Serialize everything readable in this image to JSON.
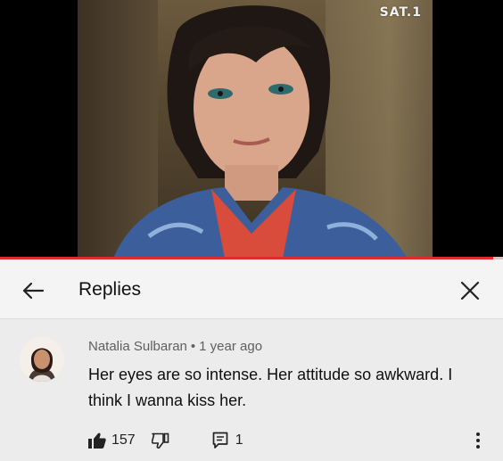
{
  "video": {
    "channel_logo": "SAT.1",
    "progress_fraction": 0.98
  },
  "replies": {
    "title": "Replies"
  },
  "comment": {
    "author": "Natalia Sulbaran",
    "separator": "•",
    "time": "1 year ago",
    "text": "Her eyes are so intense. Her attitude so awkward. I think I wanna kiss her.",
    "like_count": "157",
    "reply_count": "1"
  },
  "colors": {
    "accent_progress": "#e22b2b",
    "header_bg": "#f4f4f4",
    "comment_bg": "#ececec"
  },
  "icons": [
    "back-arrow-icon",
    "close-icon",
    "thumbs-up-icon",
    "thumbs-down-icon",
    "reply-icon",
    "more-vert-icon"
  ]
}
